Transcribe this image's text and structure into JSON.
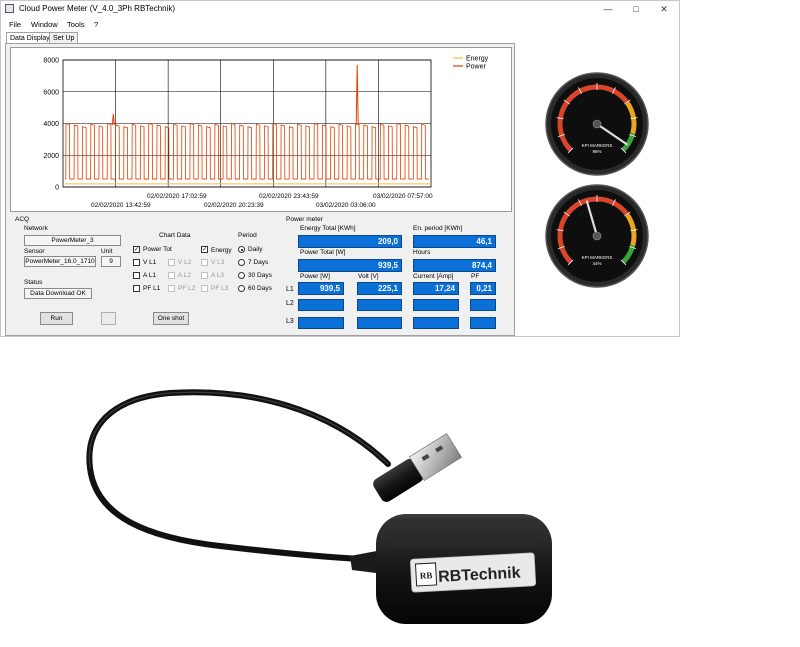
{
  "window": {
    "title": "Cloud Power Meter (V_4.0_3Ph RBTechnik)",
    "min": "—",
    "max": "□",
    "close": "✕"
  },
  "menu": [
    "File",
    "Window",
    "Tools",
    "?"
  ],
  "tabs": [
    "Data Display",
    "Set Up"
  ],
  "chart_data": {
    "type": "line",
    "ylim": [
      0,
      8000
    ],
    "y_ticks": [
      "0",
      "2000",
      "4000",
      "6000",
      "8000"
    ],
    "x_ticks_top": [
      "02/02/2020 17:02:59",
      "02/02/2020 23:43:59",
      "03/02/2020 07:57:00"
    ],
    "x_ticks_bottom": [
      "02/02/2020 13:42:59",
      "02/02/2020 20:23:39",
      "03/02/2020 03:06:00"
    ],
    "legend": "top-right",
    "series": [
      {
        "name": "Energy",
        "color": "#f0c040",
        "values": [
          200,
          200
        ]
      },
      {
        "name": "Power",
        "color": "#e04000",
        "pattern": {
          "low": 500,
          "high": 3900,
          "cycles": 44
        },
        "spikes": [
          [
            0.13,
            4600
          ],
          [
            0.8,
            7700
          ]
        ]
      }
    ]
  },
  "acq": {
    "title": "ACQ",
    "network_label": "Network",
    "network_value": "PowerMeter_3",
    "sensor_label": "Sensor",
    "sensor_value": "PowerMeter_16.0_1710",
    "unit_label": "Unit",
    "unit_value": "9",
    "status_label": "Status",
    "status_value": "Data Download OK",
    "run": "Run",
    "one_shot": "One shot"
  },
  "chart_options": {
    "title": "Chart Data",
    "power_tot": "Power Tot",
    "energy": "Energy",
    "vl1": "V L1",
    "vl2": "V L2",
    "vl3": "V L3",
    "al1": "A L1",
    "al2": "A L2",
    "al3": "A L3",
    "pfl1": "PF L1",
    "pfl2": "PF L2",
    "pfl3": "PF L3"
  },
  "period": {
    "title": "Period",
    "daily": "Daily",
    "d7": "7 Days",
    "d30": "30 Days",
    "d60": "60 Days"
  },
  "power_meter": {
    "title": "Power meter",
    "energy_total_label": "Energy Total  [KWh]",
    "energy_total": "209,0",
    "en_period_label": "En. period [KWh]",
    "en_period": "46,1",
    "power_total_label": "Power Total  [W]",
    "power_total": "939,5",
    "hours_label": "Hours",
    "hours": "874,4",
    "power_label": "Power [W]",
    "volt_label": "Volt [V]",
    "current_label": "Current [Amp]",
    "pf_label": "PF",
    "l1": "L1",
    "l2": "L2",
    "l3": "L3",
    "l1_power": "939,5",
    "l1_volt": "225,1",
    "l1_current": "17,24",
    "l1_pf": "0,21"
  },
  "gauges": [
    {
      "label": "KPI MARKERS",
      "percent": 96,
      "text": "96%"
    },
    {
      "label": "KPI MARKERS",
      "percent": 44,
      "text": "44%"
    }
  ],
  "device": {
    "brand": "RBTechnik",
    "logo": "RB"
  }
}
